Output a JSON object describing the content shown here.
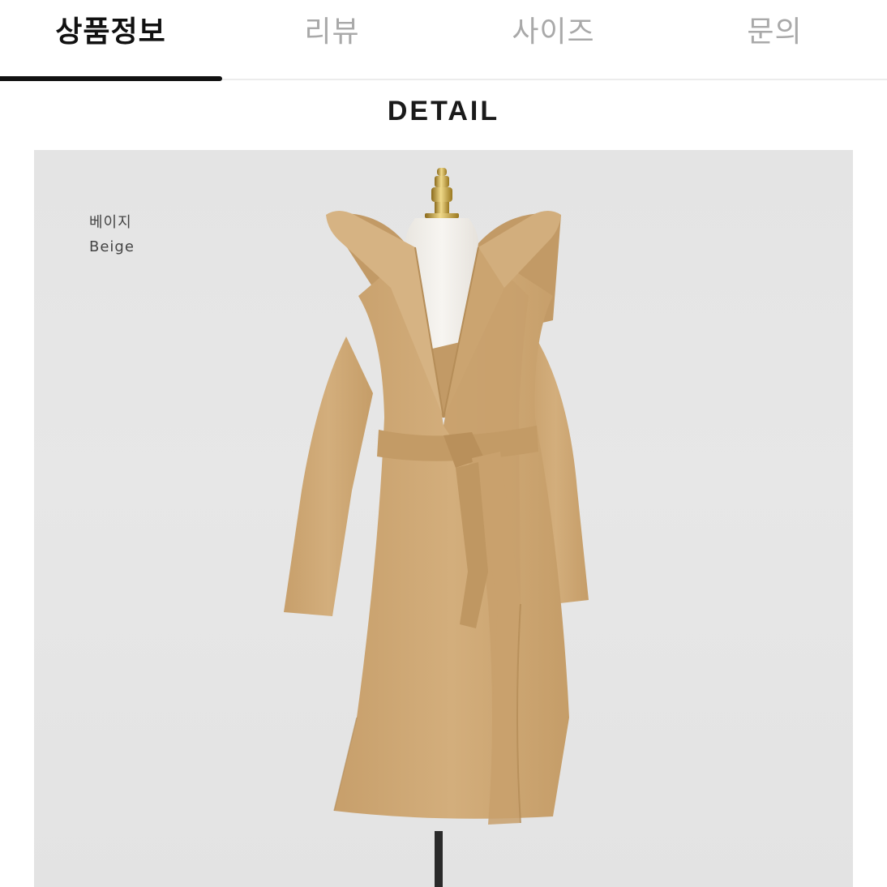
{
  "tabs": [
    {
      "label": "상품정보",
      "active": true
    },
    {
      "label": "리뷰",
      "active": false
    },
    {
      "label": "사이즈",
      "active": false
    },
    {
      "label": "문의",
      "active": false
    }
  ],
  "detail": {
    "heading": "DETAIL"
  },
  "product": {
    "color_name_ko": "베이지",
    "color_name_en": "Beige",
    "color_hex": "#CFA976",
    "image_icon": "coat-on-mannequin-image"
  },
  "colors": {
    "active_tab": "#111111",
    "inactive_tab": "#A9A9A9",
    "image_background": "#E5E5E5"
  }
}
